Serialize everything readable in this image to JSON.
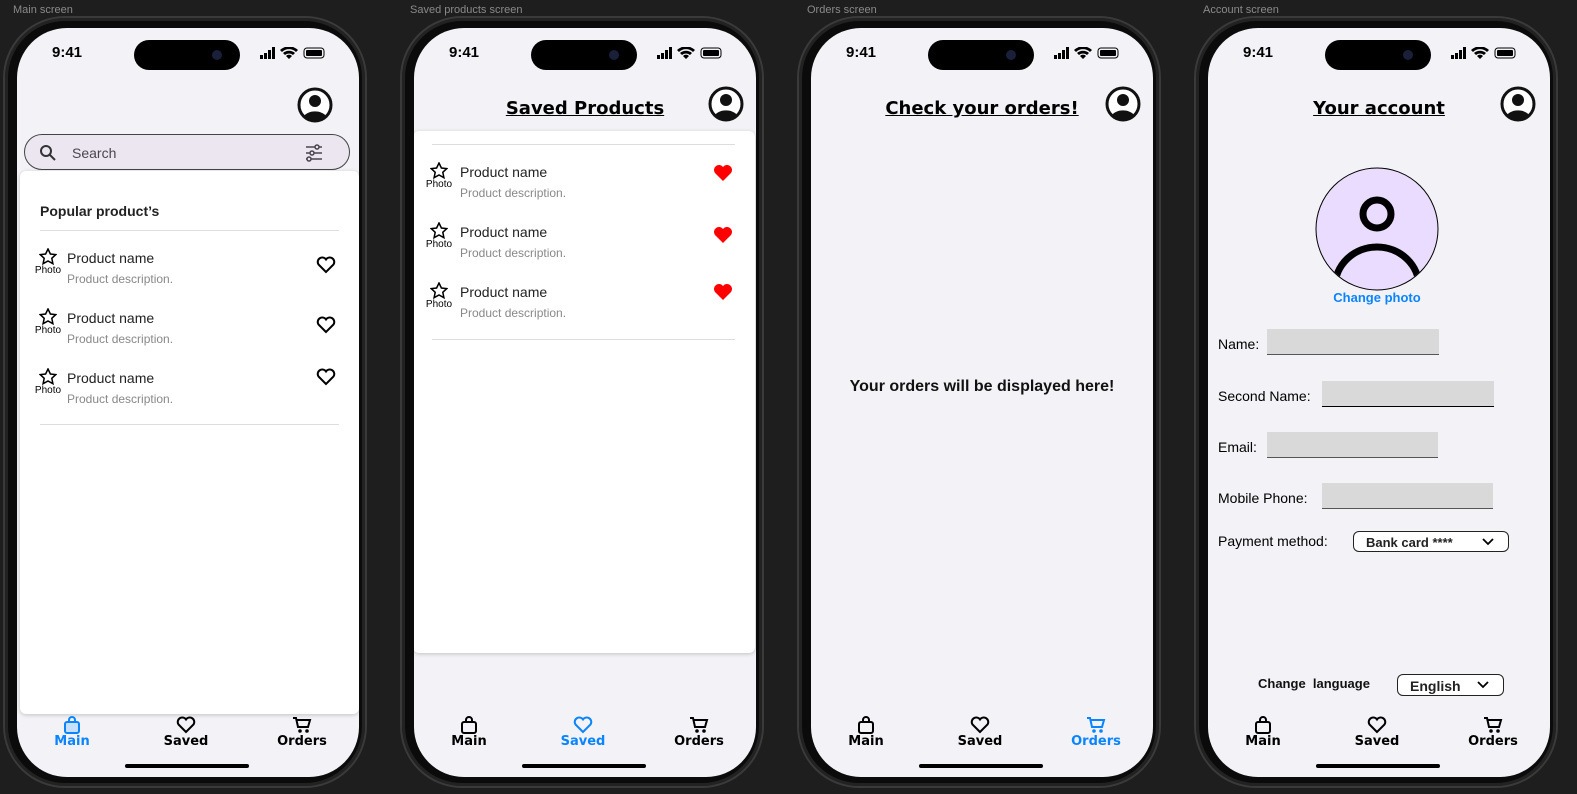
{
  "frames": [
    "Main screen",
    "Saved products screen",
    "Orders screen",
    "Account screen"
  ],
  "status_time": "9:41",
  "tabs": {
    "main": "Main",
    "saved": "Saved",
    "orders": "Orders"
  },
  "main": {
    "search_placeholder": "Search",
    "section_title": "Popular product’s",
    "products": [
      {
        "photo": "Photo",
        "name": "Product name",
        "description": "Product description."
      },
      {
        "photo": "Photo",
        "name": "Product name",
        "description": "Product description."
      },
      {
        "photo": "Photo",
        "name": "Product name",
        "description": "Product description."
      }
    ]
  },
  "saved": {
    "title": "Saved Products",
    "products": [
      {
        "photo": "Photo",
        "name": "Product name",
        "description": "Product description."
      },
      {
        "photo": "Photo",
        "name": "Product name",
        "description": "Product description."
      },
      {
        "photo": "Photo",
        "name": "Product name",
        "description": "Product description."
      }
    ]
  },
  "orders": {
    "title": "Check your orders!",
    "empty_message": "Your orders will be displayed here!"
  },
  "account": {
    "title": "Your account",
    "change_photo": "Change photo",
    "name_label": "Name:",
    "second_name_label": "Second Name:",
    "email_label": "Email:",
    "phone_label": "Mobile Phone:",
    "payment_label": "Payment method:",
    "payment_value": "Bank card ****",
    "language_label": "Change  language",
    "language_value": "English"
  },
  "colors": {
    "accent": "#0a84ff",
    "heart": "#ff0000",
    "search_bg": "#ece6f0",
    "avatar_bg": "#eadcff"
  }
}
